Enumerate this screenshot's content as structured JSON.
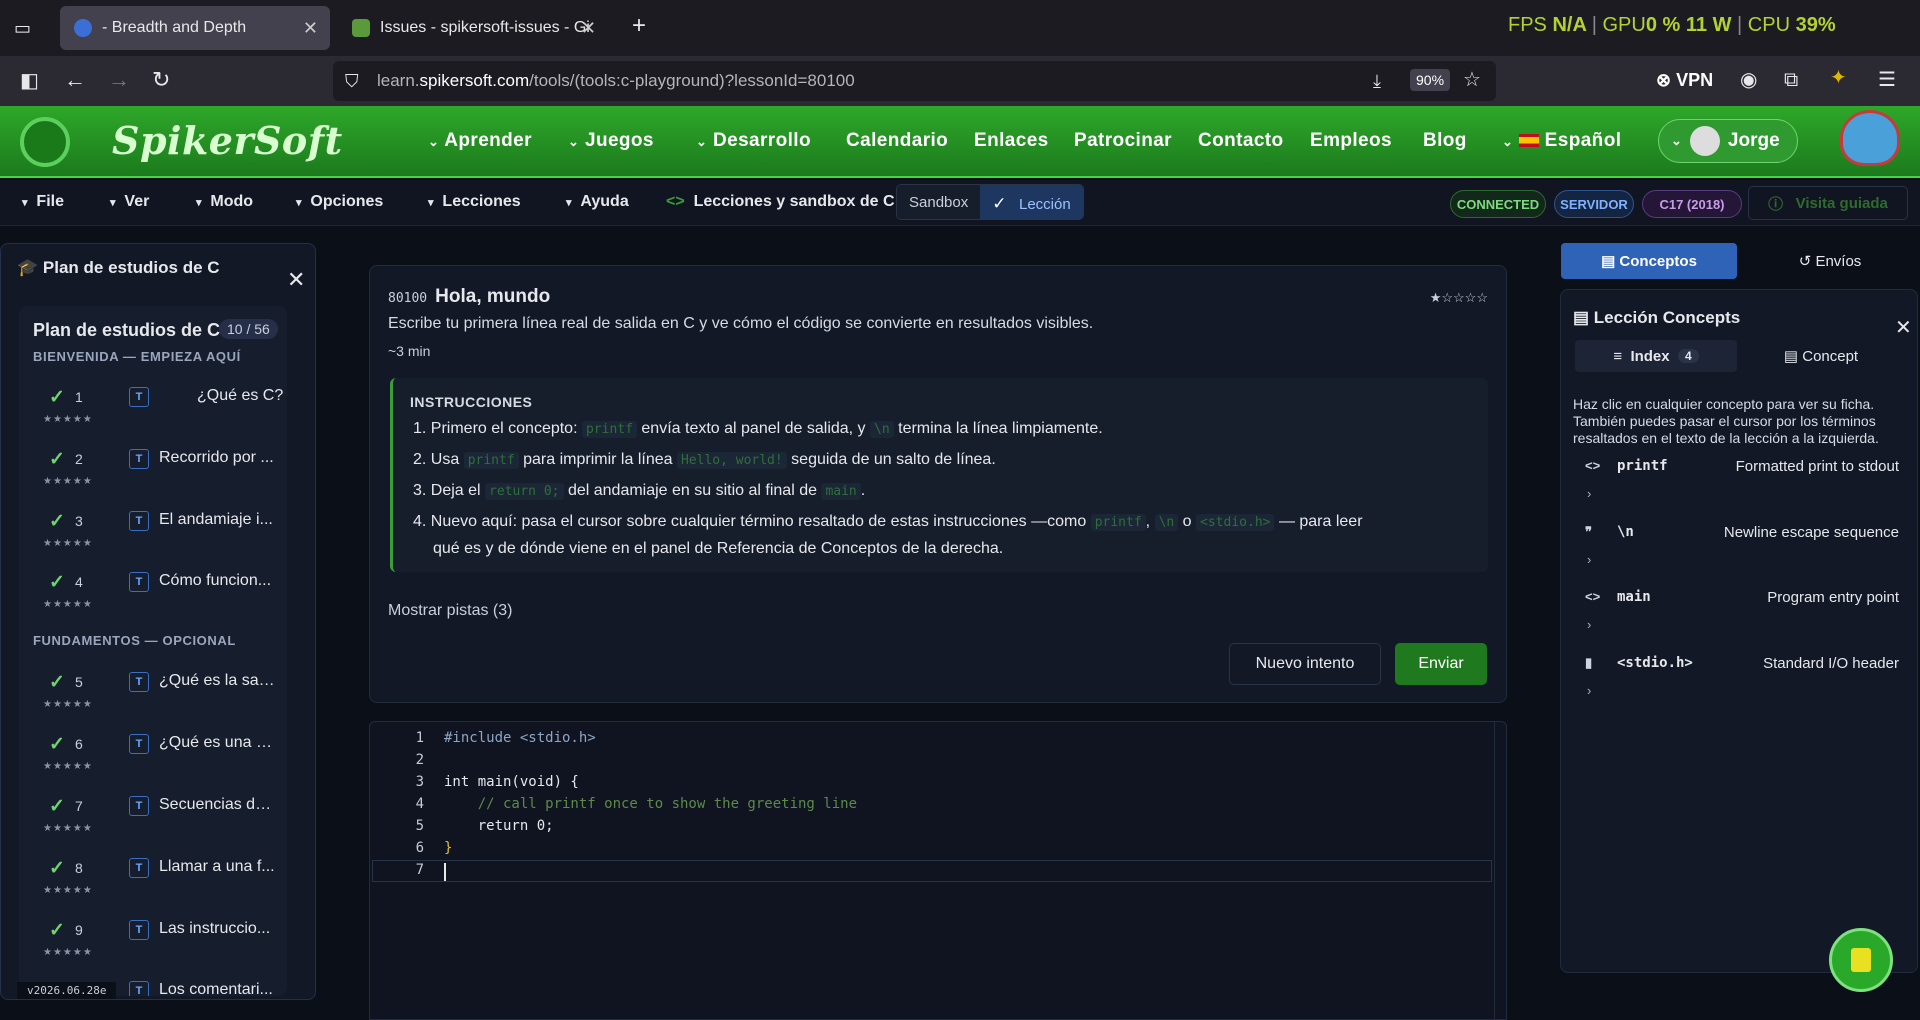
{
  "browser": {
    "tabs": [
      {
        "label": "- Breadth and Depth",
        "active": true
      },
      {
        "label": "Issues - spikersoft-issues - Gitea"
      }
    ],
    "overlay": {
      "fps_label": "FPS",
      "fps_value": "N/A",
      "gpu_label": "GPU",
      "gpu_value": "0 %",
      "watts": "11 W",
      "cpu_label": "CPU",
      "cpu_value": "39%"
    },
    "url_prefix": "learn.",
    "url_domain": "spikersoft.com",
    "url_path": "/tools/(tools:c-playground)?lessonId=80100",
    "zoom": "90%",
    "vpn": "VPN"
  },
  "site": {
    "logo": "SpikerSoft",
    "nav": [
      {
        "label": "Aprender",
        "dropdown": true
      },
      {
        "label": "Juegos",
        "dropdown": true
      },
      {
        "label": "Desarrollo",
        "dropdown": true
      },
      {
        "label": "Calendario"
      },
      {
        "label": "Enlaces"
      },
      {
        "label": "Patrocinar"
      },
      {
        "label": "Contacto"
      },
      {
        "label": "Empleos"
      },
      {
        "label": "Blog"
      }
    ],
    "language": "Español",
    "user": "Jorge"
  },
  "menubar": {
    "items": [
      "File",
      "Ver",
      "Modo",
      "Opciones",
      "Lecciones",
      "Ayuda"
    ],
    "breadcrumb": "Lecciones y sandbox de C",
    "toggle_sandbox": "Sandbox",
    "toggle_lesson": "Lección",
    "badges": [
      "CONNECTED",
      "SERVIDOR",
      "C17 (2018)"
    ],
    "tour": "Visita guiada"
  },
  "sidebar": {
    "title": "Plan de estudios de C",
    "card_title": "Plan de estudios de C",
    "progress": "10 / 56",
    "section1": "BIENVENIDA — EMPIEZA AQUÍ",
    "section2": "FUNDAMENTOS — OPCIONAL",
    "lessons": [
      {
        "n": "1",
        "title": "¿Qué es C?"
      },
      {
        "n": "2",
        "title": "Recorrido por ..."
      },
      {
        "n": "3",
        "title": "El andamiaje i..."
      },
      {
        "n": "4",
        "title": "Cómo funcion..."
      },
      {
        "n": "5",
        "title": "¿Qué es la sali..."
      },
      {
        "n": "6",
        "title": "¿Qué es una c..."
      },
      {
        "n": "7",
        "title": "Secuencias de..."
      },
      {
        "n": "8",
        "title": "Llamar a una f..."
      },
      {
        "n": "9",
        "title": "Las instruccio..."
      },
      {
        "n": "",
        "title": "Los comentari..."
      }
    ],
    "type_badge": "T",
    "stars": "★★★★★",
    "version": "v2026.06.28e"
  },
  "lesson": {
    "id": "80100",
    "title": "Hola, mundo",
    "stars": "★☆☆☆☆",
    "desc": "Escribe tu primera línea real de salida en C y ve cómo el código se convierte en resultados visibles.",
    "time": "~3 min",
    "instr_title": "INSTRUCCIONES",
    "s1a": "1. Primero el concepto:",
    "s1c": "printf",
    "s1b": "envía texto al panel de salida, y",
    "s1d": "\\n",
    "s1e": "termina la línea limpiamente.",
    "s2a": "2. Usa",
    "s2c": "printf",
    "s2b": "para imprimir la línea",
    "s2d": "Hello, world!",
    "s2e": "seguida de un salto de línea.",
    "s3a": "3. Deja el",
    "s3c": "return 0;",
    "s3b": "del andamiaje en su sitio al final de",
    "s3d": "main",
    "s3e": ".",
    "s4a": "4. Nuevo aquí: pasa el cursor sobre cualquier término resaltado de estas instrucciones —como",
    "s4c": "printf",
    "s4s": ",",
    "s4d": "\\n",
    "s4o": "o",
    "s4e": "<stdio.h>",
    "s4f": "— para leer",
    "s4g": "qué es y de dónde viene en el panel de Referencia de Conceptos de la derecha.",
    "hints": "Mostrar pistas (3)",
    "retry": "Nuevo intento",
    "submit": "Enviar"
  },
  "editor": {
    "lines": [
      {
        "n": "1",
        "code": "#include <stdio.h>",
        "cls": "inc"
      },
      {
        "n": "2",
        "code": "",
        "cls": ""
      },
      {
        "n": "3",
        "code": "int main(void) {",
        "cls": "fn"
      },
      {
        "n": "4",
        "code": "    // call printf once to show the greeting line",
        "cls": "cm"
      },
      {
        "n": "5",
        "code": "    return 0;",
        "cls": "rt"
      },
      {
        "n": "6",
        "code": "}",
        "cls": "br"
      },
      {
        "n": "7",
        "code": "",
        "cls": ""
      }
    ]
  },
  "right": {
    "tab_concepts": "Conceptos",
    "tab_submissions": "Envíos",
    "panel_title": "Lección Concepts",
    "index_label": "Index",
    "index_count": "4",
    "concept_tab": "Concept",
    "help": "Haz clic en cualquier concepto para ver su ficha. También puedes pasar el cursor por los términos resaltados en el texto de la lección a la izquierda.",
    "concepts": [
      {
        "icon": "<>",
        "name": "printf",
        "desc": "Formatted print to stdout"
      },
      {
        "icon": "❞",
        "name": "\\n",
        "desc": "Newline escape sequence"
      },
      {
        "icon": "<>",
        "name": "main",
        "desc": "Program entry point"
      },
      {
        "icon": "▮",
        "name": "<stdio.h>",
        "desc": "Standard I/O header"
      }
    ]
  },
  "colors": {
    "brand_green": "#2ea82a",
    "submit_green": "#1f7a1f",
    "accent_blue": "#2f63b8"
  }
}
